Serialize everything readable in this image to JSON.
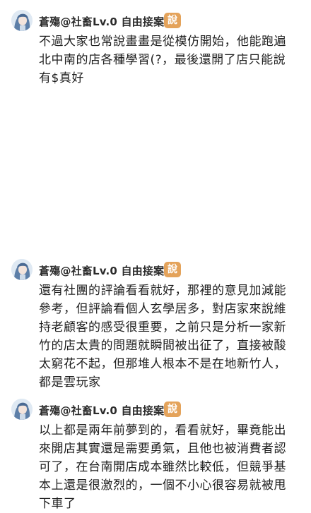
{
  "comments": [
    {
      "username": "蒼殤@社畜Lv.0 自由接案",
      "badge": "說",
      "lines": [
        "不過大家也常說畫畫是從模仿開始，他能跑遍",
        "北中南的店各種學習(?，最後還開了店只能說",
        "有$真好"
      ]
    },
    {
      "username": "蒼殤@社畜Lv.0 自由接案",
      "badge": "說",
      "lines": [
        "還有社團的評論看看就好，那裡的意見加減能",
        "參考，但評論看個人玄學居多，對店家來說維",
        "持老顧客的感受很重要，之前只是分析一家新",
        "竹的店太貴的問題就瞬間被出征了，直接被酸",
        "太窮花不起，但那堆人根本不是在地新竹人，",
        "都是雲玩家"
      ]
    },
    {
      "username": "蒼殤@社畜Lv.0 自由接案",
      "badge": "說",
      "lines": [
        "以上都是兩年前夢到的，看看就好，畢竟能出",
        "來開店其實還是需要勇氣，且他也被消費者認",
        "可了，在台南開店成本雖然比較低，但競爭基",
        "本上還是很激烈的，一個不小心很容易就被甩",
        "下車了"
      ]
    }
  ]
}
